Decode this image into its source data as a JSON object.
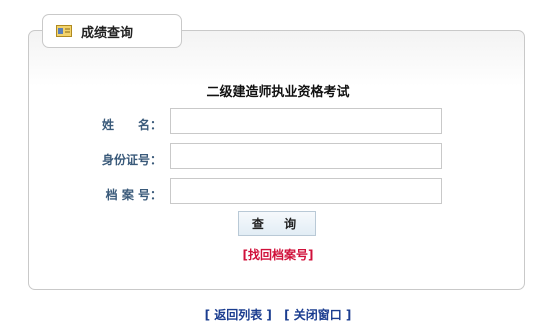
{
  "tab": {
    "label": "成绩查询",
    "icon": "id-card-icon"
  },
  "form": {
    "title": "二级建造师执业资格考试",
    "name_label": "姓　　名：",
    "id_label": "身份证号：",
    "file_label": "档 案 号：",
    "name_value": "",
    "id_value": "",
    "file_value": ""
  },
  "query_button": "查 询",
  "recover_link": "[找回档案号]",
  "footer": {
    "back_link": "[ 返回列表 ]",
    "close_link": "[ 关闭窗口 ]"
  },
  "colors": {
    "label": "#3a5a7a",
    "recover": "#d0103a",
    "footer_link": "#1a3c8f"
  }
}
